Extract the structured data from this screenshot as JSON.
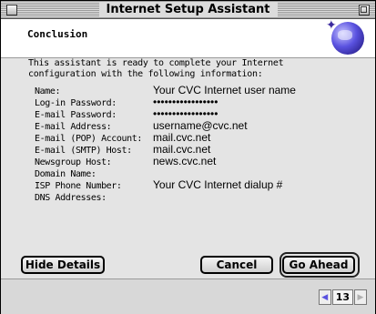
{
  "window": {
    "title": "Internet Setup Assistant"
  },
  "header": {
    "section": "Conclusion"
  },
  "intro": "This assistant is ready to complete your Internet configuration with the following information:",
  "details": [
    {
      "label": "Name:",
      "value": "Your CVC Internet user name"
    },
    {
      "label": "Log-in Password:",
      "value": "•••••••••••••••••"
    },
    {
      "label": "E-mail Password:",
      "value": "•••••••••••••••••"
    },
    {
      "label": "E-mail Address:",
      "value": "username@cvc.net"
    },
    {
      "label": "E-mail (POP) Account:",
      "value": "mail.cvc.net"
    },
    {
      "label": "E-mail (SMTP) Host:",
      "value": "mail.cvc.net"
    },
    {
      "label": "Newsgroup Host:",
      "value": "news.cvc.net"
    },
    {
      "label": "Domain Name:",
      "value": ""
    },
    {
      "label": "ISP Phone Number:",
      "value": "Your CVC Internet dialup #"
    },
    {
      "label": "DNS Addresses:",
      "value": ""
    }
  ],
  "buttons": {
    "hide_details": "Hide Details",
    "cancel": "Cancel",
    "go_ahead": "Go Ahead"
  },
  "pager": {
    "page": "13"
  },
  "colors": {
    "accent": "#5a52e0"
  }
}
